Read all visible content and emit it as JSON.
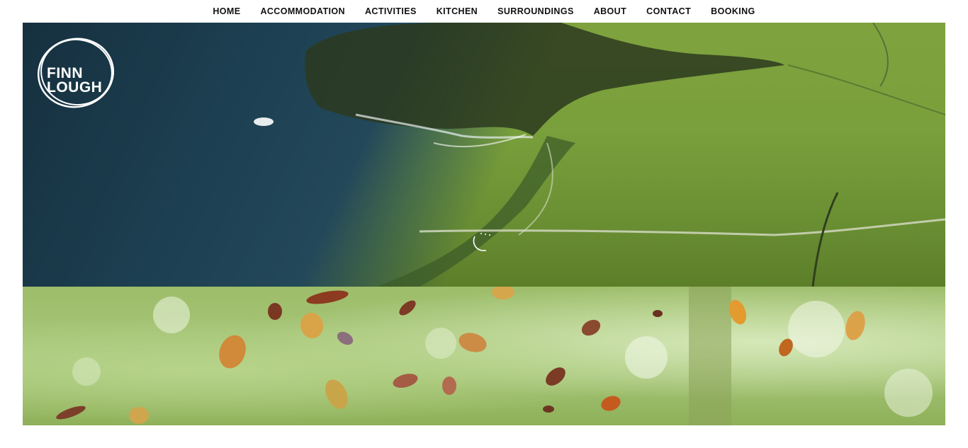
{
  "nav": {
    "items": [
      {
        "label": "HOME"
      },
      {
        "label": "ACCOMMODATION"
      },
      {
        "label": "ACTIVITIES"
      },
      {
        "label": "KITCHEN"
      },
      {
        "label": "SURROUNDINGS"
      },
      {
        "label": "ABOUT"
      },
      {
        "label": "CONTACT"
      },
      {
        "label": "BOOKING"
      }
    ]
  },
  "logo": {
    "line1": "FINN",
    "line2": "LOUGH"
  },
  "hero": {
    "scroll_icon": "hand-swipe-icon"
  },
  "colors": {
    "nav_text": "#111111",
    "sea": "#1d4153",
    "grass": "#7fa23e"
  }
}
